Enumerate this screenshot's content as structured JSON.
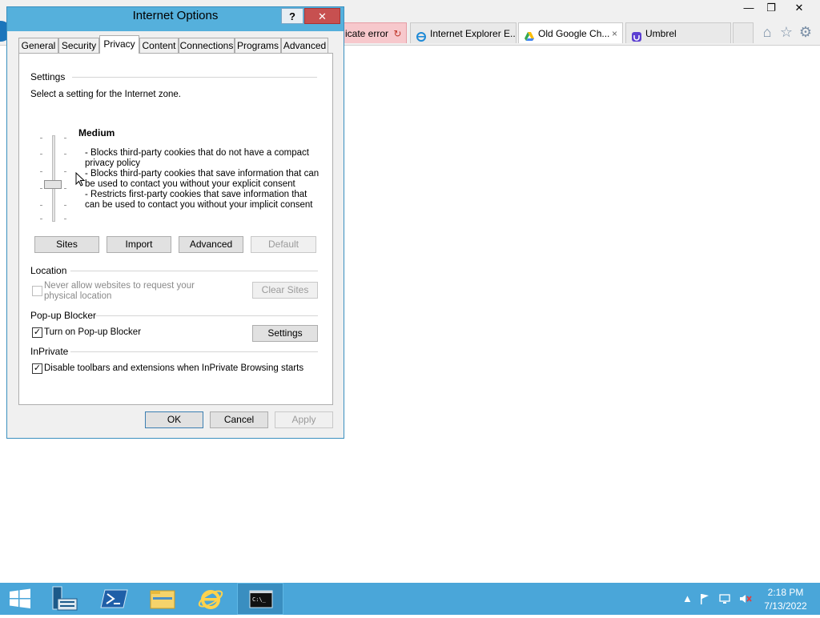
{
  "browser": {
    "tabs": [
      {
        "label": "icate error",
        "icon": "refresh-icon"
      },
      {
        "label": "Internet Explorer E...",
        "icon": "ie-icon"
      },
      {
        "label": "Old Google Ch...",
        "icon": "google-drive-icon"
      },
      {
        "label": "Umbrel",
        "icon": "umbrel-icon"
      }
    ],
    "tab_close": "×",
    "window_controls": {
      "minimize": "—",
      "maximize": "❐",
      "close": "✕"
    },
    "toolbar_icons": [
      "home-icon",
      "favorites-star-icon",
      "gear-icon"
    ]
  },
  "dialog": {
    "title": "Internet Options",
    "help": "?",
    "close": "✕",
    "tabs": [
      "General",
      "Security",
      "Privacy",
      "Content",
      "Connections",
      "Programs",
      "Advanced"
    ],
    "active_tab": "Privacy",
    "settings": {
      "header": "Settings",
      "zone_text": "Select a setting for the Internet zone.",
      "level": "Medium",
      "desc_1a": "- Blocks third-party cookies that do not have a compact",
      "desc_1b": "privacy policy",
      "desc_2a": "- Blocks third-party cookies that save information that can",
      "desc_2b": "be used to contact you without your explicit consent",
      "desc_3a": "- Restricts first-party cookies that save information that",
      "desc_3b": "can be used to contact you without your implicit consent",
      "buttons": {
        "sites": "Sites",
        "import": "Import",
        "advanced": "Advanced",
        "default": "Default"
      }
    },
    "location": {
      "header": "Location",
      "checkbox_a": "Never allow websites to request your",
      "checkbox_b": "physical location",
      "checked": false,
      "clear_sites": "Clear Sites"
    },
    "popup": {
      "header": "Pop-up Blocker",
      "checkbox": "Turn on Pop-up Blocker",
      "checked": true,
      "settings": "Settings"
    },
    "inprivate": {
      "header": "InPrivate",
      "checkbox": "Disable toolbars and extensions when InPrivate Browsing starts",
      "checked": true
    },
    "footer": {
      "ok": "OK",
      "cancel": "Cancel",
      "apply": "Apply"
    },
    "check_mark": "✓"
  },
  "taskbar": {
    "items": [
      "windows-start-icon",
      "server-manager-icon",
      "powershell-icon",
      "file-explorer-icon",
      "internet-explorer-icon",
      "command-prompt-icon"
    ],
    "tray": [
      "show-hidden-icons-icon",
      "flag-icon",
      "network-icon",
      "volume-muted-icon"
    ],
    "tray_up": "▲",
    "time": "2:18 PM",
    "date": "7/13/2022"
  },
  "colors": {
    "taskbar": "#4aa6d9",
    "dialog_frame": "#55b0dc",
    "close": "#c75050",
    "cert_error_tab": "#f7c8cc"
  }
}
